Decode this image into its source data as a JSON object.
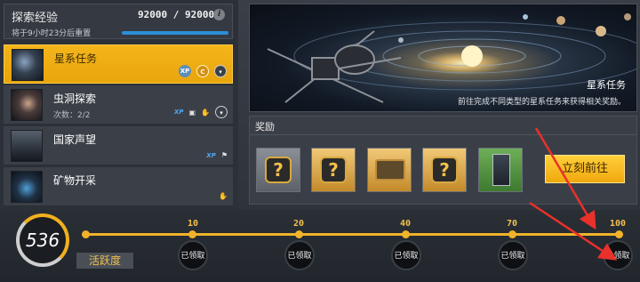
{
  "exploration": {
    "title": "探索经验",
    "value": "92000 / 92000",
    "reset_text": "将于9小时23分后重置",
    "info_icon": "i"
  },
  "tasks": [
    {
      "name": "星系任务",
      "sub": "",
      "icons": [
        "xp-coin-icon",
        "gold-coin-icon",
        "shield-icon"
      ]
    },
    {
      "name": "虫洞探索",
      "sub": "次数：2/2",
      "icons": [
        "xp-icon",
        "card-icon",
        "hand-icon",
        "shield-icon"
      ]
    },
    {
      "name": "国家声望",
      "sub": "",
      "icons": [
        "xp-icon",
        "flag-icon"
      ]
    },
    {
      "name": "矿物开采",
      "sub": "",
      "icons": [
        "hand-icon"
      ]
    }
  ],
  "banner": {
    "title": "星系任务",
    "description": "前往完成不同类型的星系任务来获得相关奖励。"
  },
  "rewards": {
    "title": "奖励",
    "items": [
      "mystery-box-gray",
      "mystery-box-gold",
      "treasure-chest",
      "mystery-box-gold-2",
      "card-pack-green"
    ],
    "go_button": "立刻前往"
  },
  "activity": {
    "score": "536",
    "label": "活跃度",
    "milestones": [
      {
        "value": "10",
        "status": "已领取"
      },
      {
        "value": "20",
        "status": "已领取"
      },
      {
        "value": "40",
        "status": "已领取"
      },
      {
        "value": "70",
        "status": "已领取"
      },
      {
        "value": "100",
        "status": "已领取"
      }
    ]
  },
  "colors": {
    "accent": "#f2b01e",
    "panel": "#2c3139",
    "arrow": "#e8312b",
    "progress": "#2b8fd6"
  }
}
